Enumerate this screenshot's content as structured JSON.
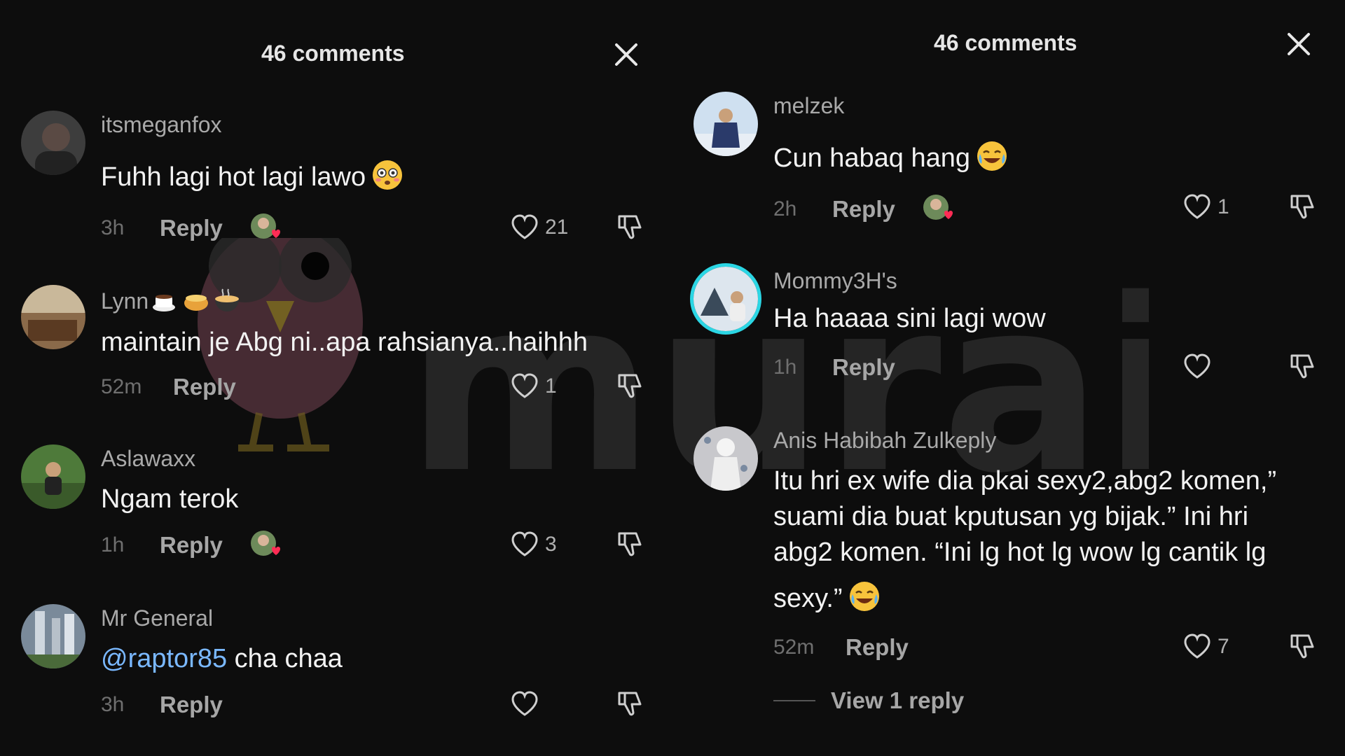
{
  "left_panel": {
    "header": {
      "title": "46 comments"
    },
    "comments": [
      {
        "username": "itsmeganfox",
        "text": "Fuhh lagi hot lagi lawo",
        "emoji": "flushed-face-emoji",
        "time": "3h",
        "reply_label": "Reply",
        "liked_by_creator": true,
        "likes": "21"
      },
      {
        "username": "Lynn",
        "username_emojis": [
          "hot-beverage-emoji",
          "pot-of-food-emoji",
          "steaming-bowl-emoji"
        ],
        "text": "maintain je Abg ni..apa rahsianya..haihhh",
        "time": "52m",
        "reply_label": "Reply",
        "liked_by_creator": false,
        "likes": "1"
      },
      {
        "username": "Aslawaxx",
        "text": "Ngam terok",
        "time": "1h",
        "reply_label": "Reply",
        "liked_by_creator": true,
        "likes": "3"
      },
      {
        "username": "Mr General",
        "mention": "@raptor85",
        "text": " cha chaa",
        "time": "3h",
        "reply_label": "Reply",
        "liked_by_creator": false,
        "likes": ""
      }
    ]
  },
  "right_panel": {
    "header": {
      "title": "46 comments"
    },
    "comments": [
      {
        "username": "melzek",
        "text": "Cun habaq hang",
        "emoji": "joy-face-emoji",
        "time": "2h",
        "reply_label": "Reply",
        "liked_by_creator": true,
        "likes": "1"
      },
      {
        "username": "Mommy3H's",
        "text": "Ha haaaa sini lagi wow",
        "time": "1h",
        "reply_label": "Reply",
        "liked_by_creator": false,
        "likes": "",
        "avatar_ring_color": "#2bd6e4"
      },
      {
        "username": "Anis Habibah Zulkeply",
        "text_lines": [
          "Itu hri ex wife dia pkai sexy2,abg2 komen,”",
          "suami dia buat kputusan yg bijak.” Ini hri",
          "abg2 komen. “Ini lg hot lg wow lg cantik lg",
          "sexy.”"
        ],
        "emoji": "joy-face-emoji",
        "time": "52m",
        "reply_label": "Reply",
        "liked_by_creator": false,
        "likes": "7",
        "view_replies": "View 1 reply"
      }
    ]
  },
  "colors": {
    "background": "#0d0d0d",
    "username": "#a9a9a9",
    "text": "#f2f2f2",
    "mention": "#7ab8ff",
    "muted": "#6f6f6f",
    "creator_heart": "#fe2c55"
  },
  "watermark_brand": "murai"
}
